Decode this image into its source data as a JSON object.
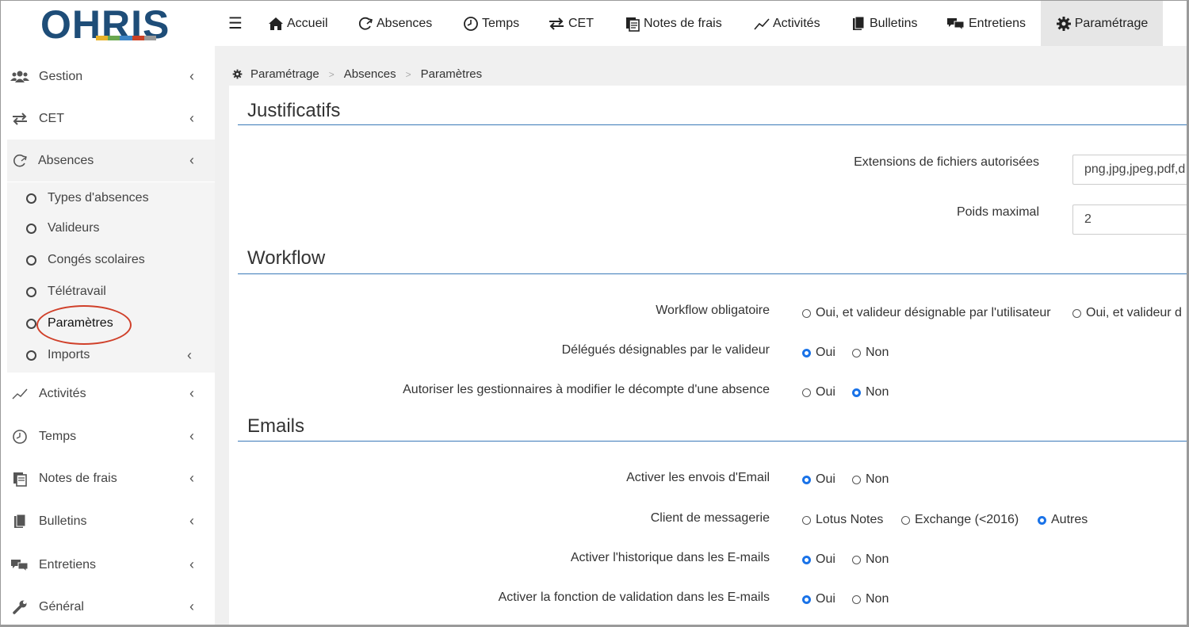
{
  "app": {
    "logo_text": "OHRIS",
    "logo_colors": [
      "#e8b32a",
      "#6aa84f",
      "#3d85c6",
      "#cc4125",
      "#999999"
    ]
  },
  "topnav": [
    {
      "label": "Accueil",
      "icon": "home-icon"
    },
    {
      "label": "Absences",
      "icon": "absence-icon"
    },
    {
      "label": "Temps",
      "icon": "clock-icon"
    },
    {
      "label": "CET",
      "icon": "transfer-arrows-icon"
    },
    {
      "label": "Notes de frais",
      "icon": "receipt-icon"
    },
    {
      "label": "Activités",
      "icon": "chart-line-icon"
    },
    {
      "label": "Bulletins",
      "icon": "document-icon"
    },
    {
      "label": "Entretiens",
      "icon": "chat-icon"
    },
    {
      "label": "Paramétrage",
      "icon": "gear-icon",
      "active": true
    }
  ],
  "sidebar": {
    "items": [
      {
        "label": "Gestion",
        "icon": "users-icon"
      },
      {
        "label": "CET",
        "icon": "transfer-arrows-icon"
      },
      {
        "label": "Absences",
        "icon": "absence-icon",
        "open": true
      },
      {
        "label": "Activités",
        "icon": "chart-line-icon"
      },
      {
        "label": "Temps",
        "icon": "clock-icon"
      },
      {
        "label": "Notes de frais",
        "icon": "receipt-icon"
      },
      {
        "label": "Bulletins",
        "icon": "document-icon"
      },
      {
        "label": "Entretiens",
        "icon": "chat-icon"
      },
      {
        "label": "Général",
        "icon": "wrench-icon"
      }
    ],
    "subitems": [
      {
        "label": "Types d'absences"
      },
      {
        "label": "Valideurs"
      },
      {
        "label": "Congés scolaires"
      },
      {
        "label": "Télétravail"
      },
      {
        "label": "Paramètres",
        "active": true
      },
      {
        "label": "Imports"
      }
    ]
  },
  "breadcrumb": [
    "Paramétrage",
    "Absences",
    "Paramètres"
  ],
  "breadcrumb_sep": ">",
  "sections": {
    "justificatifs": {
      "title": "Justificatifs",
      "extensions_label": "Extensions de fichiers autorisées",
      "extensions_value": "png,jpg,jpeg,pdf,d",
      "poids_label": "Poids maximal",
      "poids_value": "2"
    },
    "workflow": {
      "title": "Workflow",
      "obligatoire_label": "Workflow obligatoire",
      "obligatoire_opt1": "Oui, et valideur désignable par l'utilisateur",
      "obligatoire_opt2": "Oui, et valideur d",
      "delegues_label": "Délégués désignables par le valideur",
      "autoriser_label": "Autoriser les gestionnaires à modifier le décompte d'une absence"
    },
    "emails": {
      "title": "Emails",
      "envois_label": "Activer les envois d'Email",
      "client_label": "Client de messagerie",
      "client_opt1": "Lotus Notes",
      "client_opt2": "Exchange (<2016)",
      "client_opt3": "Autres",
      "historique_label": "Activer l'historique dans les E-mails",
      "validation_label": "Activer la fonction de validation dans les E-mails"
    }
  },
  "oui": "Oui",
  "non": "Non"
}
